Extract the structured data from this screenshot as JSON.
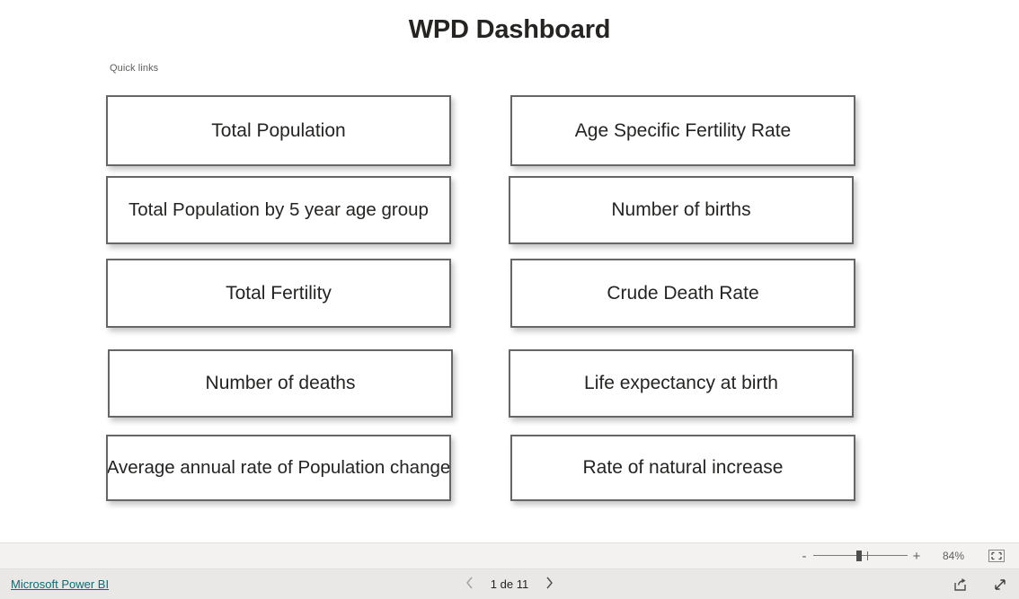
{
  "report": {
    "title": "WPD Dashboard",
    "quick_links_label": "Quick links",
    "tiles": [
      {
        "label": "Total Population",
        "column": "left",
        "row": 1
      },
      {
        "label": "Total Population by 5 year age group",
        "column": "left",
        "row": 2
      },
      {
        "label": "Total Fertility",
        "column": "left",
        "row": 3
      },
      {
        "label": "Number of deaths",
        "column": "left",
        "row": 4
      },
      {
        "label": "Average annual rate of Population change",
        "column": "left",
        "row": 5
      },
      {
        "label": "Age Specific Fertility Rate",
        "column": "right",
        "row": 1
      },
      {
        "label": "Number of births",
        "column": "right",
        "row": 2
      },
      {
        "label": "Crude Death Rate",
        "column": "right",
        "row": 3
      },
      {
        "label": "Life expectancy at birth",
        "column": "right",
        "row": 4
      },
      {
        "label": "Rate of natural increase",
        "column": "right",
        "row": 5
      }
    ]
  },
  "zoombar": {
    "minus_label": "-",
    "plus_label": "+",
    "zoom_value": "84%",
    "fit_icon": "fit-to-page-icon"
  },
  "footer": {
    "brand_label": "Microsoft Power BI",
    "prev_icon": "chevron-left-icon",
    "next_icon": "chevron-right-icon",
    "page_label": "1 de 11",
    "share_icon": "share-icon",
    "fullscreen_icon": "fullscreen-icon"
  },
  "colors": {
    "tile_border": "#666666",
    "brand_link": "#0f6c73",
    "canvas_bg": "#ffffff",
    "zoombar_bg": "#f3f2f1",
    "footer_bg": "#e9e8e7",
    "text": "#252423"
  }
}
